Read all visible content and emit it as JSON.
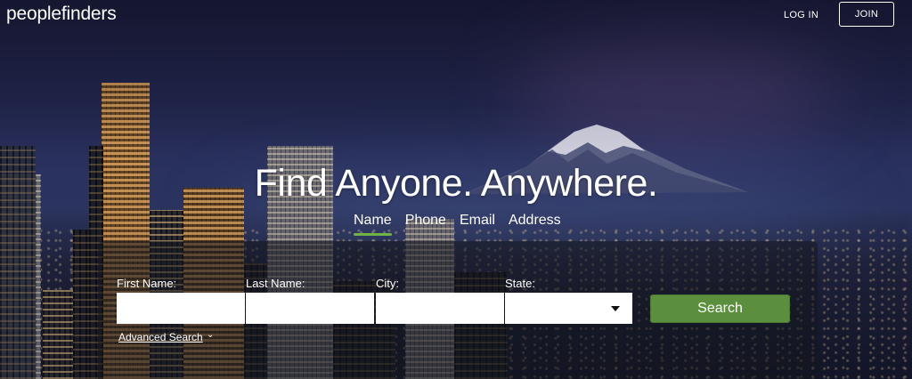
{
  "header": {
    "logo": "peoplefinders",
    "login_label": "LOG IN",
    "join_label": "JOIN"
  },
  "hero": {
    "headline": "Find Anyone. Anywhere.",
    "tabs": [
      {
        "label": "Name",
        "active": true
      },
      {
        "label": "Phone",
        "active": false
      },
      {
        "label": "Email",
        "active": false
      },
      {
        "label": "Address",
        "active": false
      }
    ]
  },
  "form": {
    "fields": [
      {
        "label": "First Name:",
        "value": "",
        "placeholder": ""
      },
      {
        "label": "Last Name:",
        "value": "",
        "placeholder": ""
      },
      {
        "label": "City:",
        "value": "",
        "placeholder": ""
      }
    ],
    "state": {
      "label": "State:",
      "selected": ""
    },
    "search_label": "Search",
    "advanced_label": "Advanced Search",
    "advanced_chevron": "⌄"
  },
  "colors": {
    "accent_green": "#6fb346",
    "button_green": "#5b8f3e"
  },
  "icons": {
    "select_caret": "caret-down-icon",
    "advanced_chevron": "chevron-down-icon"
  }
}
